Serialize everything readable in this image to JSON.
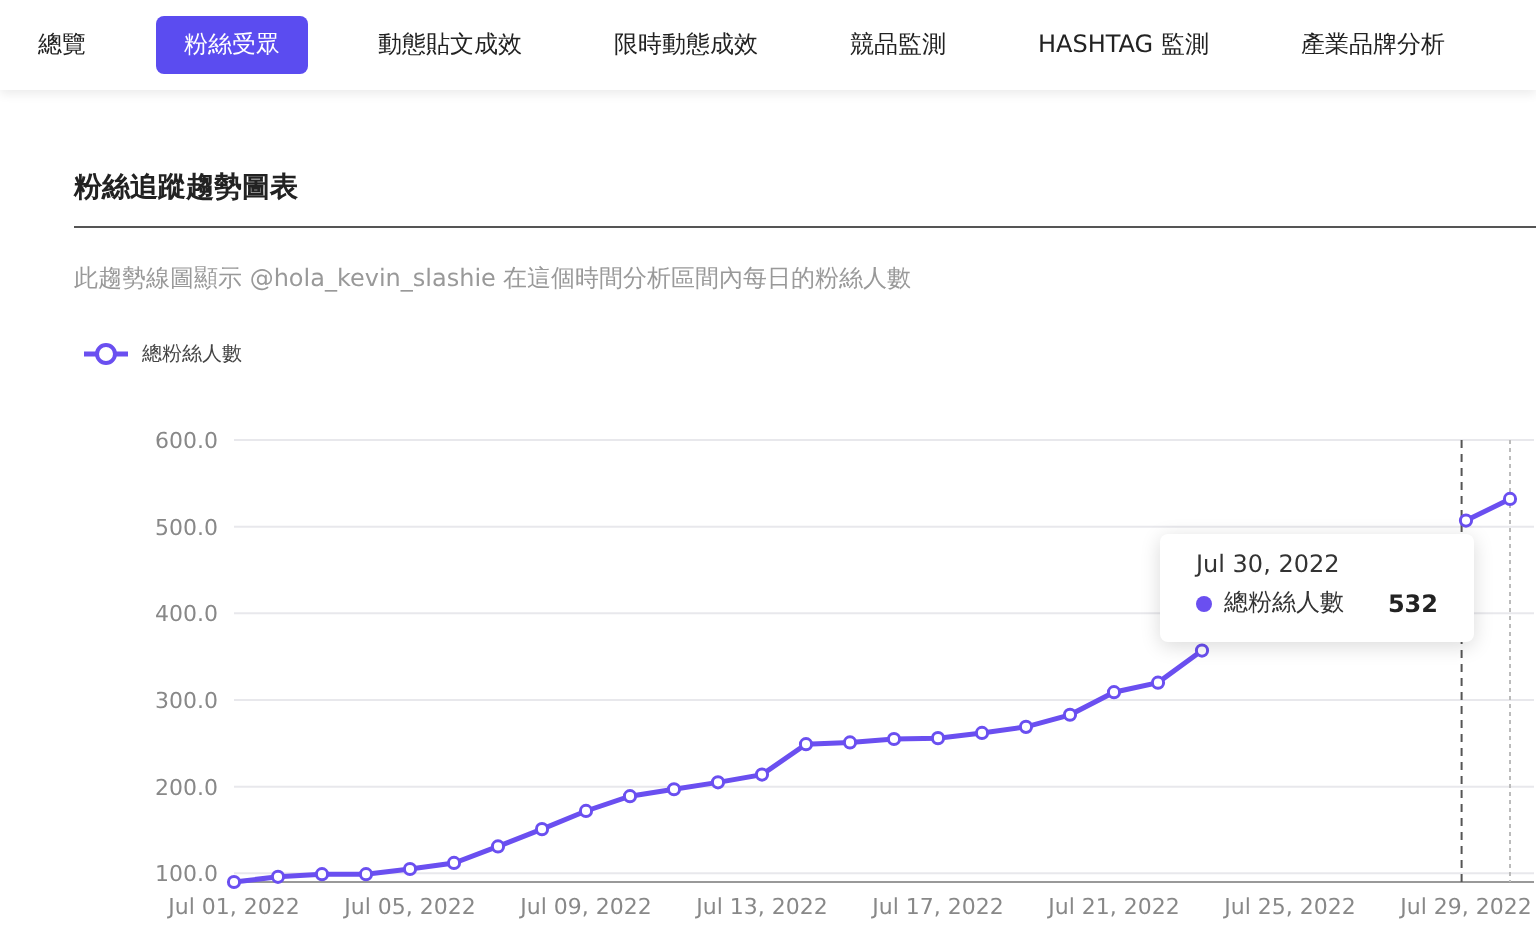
{
  "tabs": [
    {
      "label": "總覽",
      "selected": false
    },
    {
      "label": "粉絲受眾",
      "selected": true
    },
    {
      "label": "動態貼文成效",
      "selected": false
    },
    {
      "label": "限時動態成效",
      "selected": false
    },
    {
      "label": "競品監測",
      "selected": false
    },
    {
      "label": "HASHTAG 監測",
      "selected": false
    },
    {
      "label": "產業品牌分析",
      "selected": false
    }
  ],
  "section": {
    "title": "粉絲追蹤趨勢圖表",
    "description": "此趨勢線圖顯示 @hola_kevin_slashie 在這個時間分析區間內每日的粉絲人數"
  },
  "chart_data": {
    "type": "line",
    "grid": true,
    "categories": [
      "Jul 01, 2022",
      null,
      null,
      null,
      "Jul 05, 2022",
      null,
      null,
      null,
      "Jul 09, 2022",
      null,
      null,
      null,
      "Jul 13, 2022",
      null,
      null,
      null,
      "Jul 17, 2022",
      null,
      null,
      null,
      "Jul 21, 2022",
      null,
      null,
      null,
      "Jul 25, 2022",
      null,
      null,
      null,
      "Jul 29, 2022",
      null
    ],
    "series": [
      {
        "name": "總粉絲人數",
        "color": "#6a4ff0",
        "marker": true,
        "values": [
          90,
          96,
          99,
          99,
          105,
          112,
          131,
          151,
          172,
          189,
          197,
          205,
          214,
          249,
          251,
          255,
          256,
          262,
          269,
          283,
          309,
          320,
          357,
          null,
          null,
          null,
          null,
          null,
          507,
          532
        ]
      }
    ],
    "ylim": [
      90,
      600
    ],
    "yticks": [
      {
        "value": 100,
        "label": "100.0"
      },
      {
        "value": 200,
        "label": "200.0"
      },
      {
        "value": 300,
        "label": "300.0"
      },
      {
        "value": 400,
        "label": "400.0"
      },
      {
        "value": 500,
        "label": "500.0"
      },
      {
        "value": 600,
        "label": "600.0"
      }
    ]
  },
  "tooltip": {
    "date": "Jul 30, 2022",
    "series": "總粉絲人數",
    "value": "532"
  }
}
